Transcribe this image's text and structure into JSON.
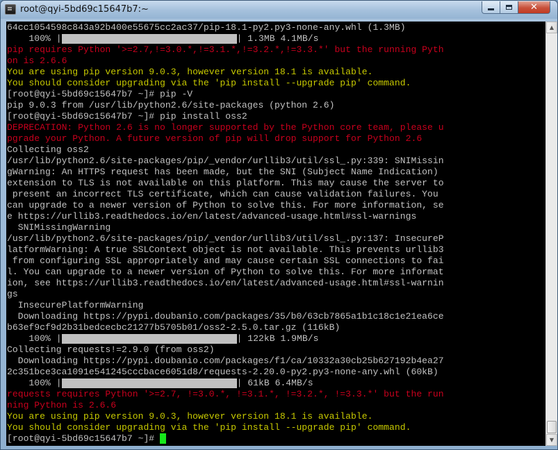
{
  "window": {
    "title": "root@qyi-5bd69c15647b7:~"
  },
  "terminal": {
    "lines": [
      {
        "color": "gray",
        "text": "64cc1054598c843a92b400e55675cc2ac37/pip-18.1-py2.py3-none-any.whl (1.3MB)"
      },
      {
        "color": "gray",
        "text": "    100% |",
        "bar": 32,
        "after": "| 1.3MB 4.1MB/s"
      },
      {
        "color": "red",
        "text": "pip requires Python '>=2.7,!=3.0.*,!=3.1.*,!=3.2.*,!=3.3.*' but the running Pyth"
      },
      {
        "color": "red",
        "text": "on is 2.6.6"
      },
      {
        "color": "yellow",
        "text": "You are using pip version 9.0.3, however version 18.1 is available."
      },
      {
        "color": "yellow",
        "text": "You should consider upgrading via the 'pip install --upgrade pip' command."
      },
      {
        "color": "gray",
        "text": "[root@qyi-5bd69c15647b7 ~]# pip -V"
      },
      {
        "color": "gray",
        "text": "pip 9.0.3 from /usr/lib/python2.6/site-packages (python 2.6)"
      },
      {
        "color": "gray",
        "text": "[root@qyi-5bd69c15647b7 ~]# pip install oss2"
      },
      {
        "color": "red",
        "text": "DEPRECATION: Python 2.6 is no longer supported by the Python core team, please u"
      },
      {
        "color": "red",
        "text": "pgrade your Python. A future version of pip will drop support for Python 2.6"
      },
      {
        "color": "gray",
        "text": "Collecting oss2"
      },
      {
        "color": "gray",
        "text": "/usr/lib/python2.6/site-packages/pip/_vendor/urllib3/util/ssl_.py:339: SNIMissin"
      },
      {
        "color": "gray",
        "text": "gWarning: An HTTPS request has been made, but the SNI (Subject Name Indication)"
      },
      {
        "color": "gray",
        "text": "extension to TLS is not available on this platform. This may cause the server to"
      },
      {
        "color": "gray",
        "text": " present an incorrect TLS certificate, which can cause validation failures. You"
      },
      {
        "color": "gray",
        "text": "can upgrade to a newer version of Python to solve this. For more information, se"
      },
      {
        "color": "gray",
        "text": "e https://urllib3.readthedocs.io/en/latest/advanced-usage.html#ssl-warnings"
      },
      {
        "color": "gray",
        "text": "  SNIMissingWarning"
      },
      {
        "color": "gray",
        "text": "/usr/lib/python2.6/site-packages/pip/_vendor/urllib3/util/ssl_.py:137: InsecureP"
      },
      {
        "color": "gray",
        "text": "latformWarning: A true SSLContext object is not available. This prevents urllib3"
      },
      {
        "color": "gray",
        "text": " from configuring SSL appropriately and may cause certain SSL connections to fai"
      },
      {
        "color": "gray",
        "text": "l. You can upgrade to a newer version of Python to solve this. For more informat"
      },
      {
        "color": "gray",
        "text": "ion, see https://urllib3.readthedocs.io/en/latest/advanced-usage.html#ssl-warnin"
      },
      {
        "color": "gray",
        "text": "gs"
      },
      {
        "color": "gray",
        "text": "  InsecurePlatformWarning"
      },
      {
        "color": "gray",
        "text": "  Downloading https://pypi.doubanio.com/packages/35/b0/63cb7865a1b1c18c1e21ea6ce"
      },
      {
        "color": "gray",
        "text": "b63ef9cf9d2b31bedcecbc21277b5705b01/oss2-2.5.0.tar.gz (116kB)"
      },
      {
        "color": "gray",
        "text": "    100% |",
        "bar": 32,
        "after": "| 122kB 1.9MB/s"
      },
      {
        "color": "gray",
        "text": "Collecting requests!=2.9.0 (from oss2)"
      },
      {
        "color": "gray",
        "text": "  Downloading https://pypi.doubanio.com/packages/f1/ca/10332a30cb25b627192b4ea27"
      },
      {
        "color": "gray",
        "text": "2c351bce3ca1091e541245cccbace6051d8/requests-2.20.0-py2.py3-none-any.whl (60kB)"
      },
      {
        "color": "gray",
        "text": "    100% |",
        "bar": 32,
        "after": "| 61kB 6.4MB/s"
      },
      {
        "color": "red",
        "text": "requests requires Python '>=2.7, !=3.0.*, !=3.1.*, !=3.2.*, !=3.3.*' but the run"
      },
      {
        "color": "red",
        "text": "ning Python is 2.6.6"
      },
      {
        "color": "yellow",
        "text": "You are using pip version 9.0.3, however version 18.1 is available."
      },
      {
        "color": "yellow",
        "text": "You should consider upgrading via the 'pip install --upgrade pip' command."
      },
      {
        "color": "gray",
        "text": "[root@qyi-5bd69c15647b7 ~]# ",
        "cursor": true
      }
    ]
  },
  "colors": {
    "background": "#000000",
    "text": "#c0c0c0",
    "error": "#c8001d",
    "warning": "#c6c800",
    "cursor": "#17e81b"
  },
  "icons": {
    "app": "terminal-icon",
    "minimize": "minimize-icon",
    "maximize": "maximize-icon",
    "close": "close-icon"
  }
}
